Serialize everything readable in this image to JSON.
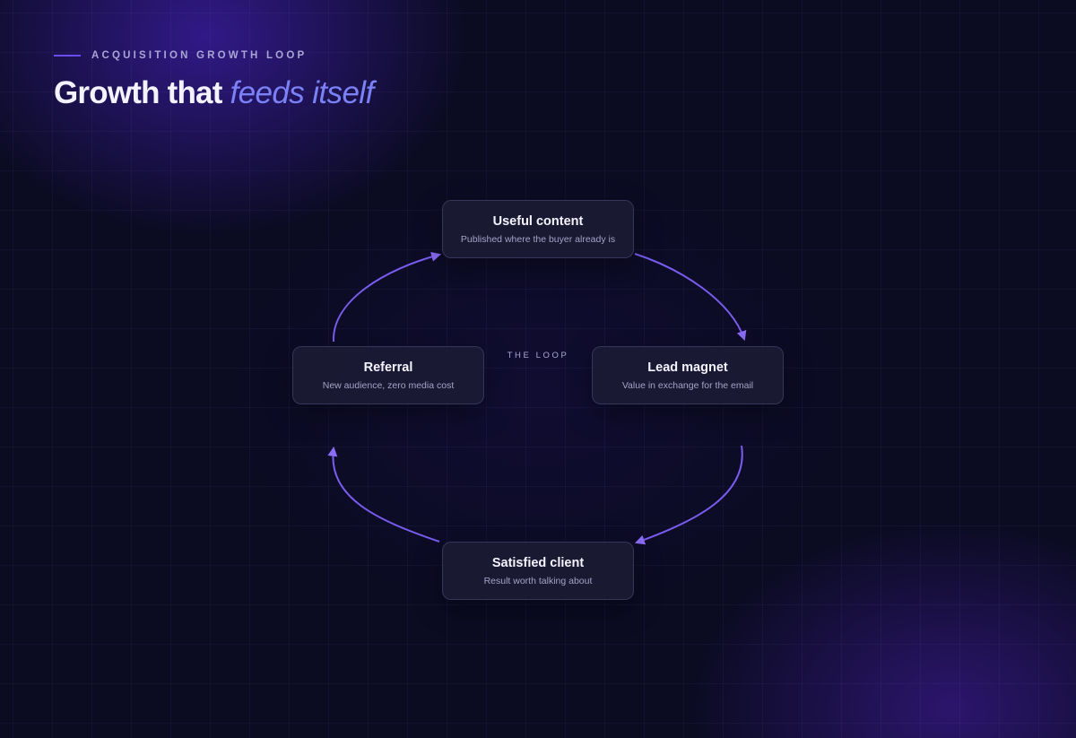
{
  "header": {
    "eyebrow": "ACQUISITION GROWTH LOOP",
    "title_main": "Growth that ",
    "title_accent": "feeds itself"
  },
  "diagram": {
    "center_label": "THE LOOP",
    "nodes": {
      "top": {
        "title": "Useful content",
        "subtitle": "Published where the buyer already is"
      },
      "right": {
        "title": "Lead magnet",
        "subtitle": "Value in exchange for the email"
      },
      "bottom": {
        "title": "Satisfied client",
        "subtitle": "Result worth talking about"
      },
      "left": {
        "title": "Referral",
        "subtitle": "New audience, zero media cost"
      }
    },
    "edges": [
      {
        "from": "Useful content",
        "to": "Lead magnet"
      },
      {
        "from": "Lead magnet",
        "to": "Satisfied client"
      },
      {
        "from": "Satisfied client",
        "to": "Referral"
      },
      {
        "from": "Referral",
        "to": "Useful content"
      }
    ]
  },
  "colors": {
    "background": "#0b0b22",
    "accent": "#6a4cf0",
    "arrow": "#7a5cf0",
    "title_accent": "#7b82f8"
  }
}
